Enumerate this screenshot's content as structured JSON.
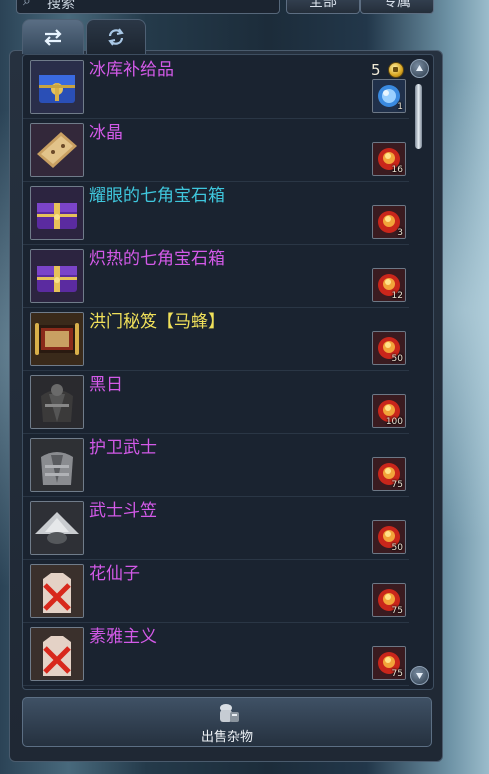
{
  "top": {
    "search_text": "搜索",
    "filter_all": "全部",
    "filter_special": "专属"
  },
  "tabs": [
    {
      "name": "exchange",
      "icon": "swap-arrows-icon",
      "active": true
    },
    {
      "name": "buyback",
      "icon": "refresh-icon",
      "active": false
    }
  ],
  "currency": {
    "gold_price": "5",
    "icon": "gold-coin-icon"
  },
  "items": [
    {
      "name": "冰库补给品",
      "color": "#d35ae8",
      "icon": "blue-chest-icon",
      "cost_icon": "blue-orb-token-icon",
      "cost_amount": "1"
    },
    {
      "name": "冰晶",
      "color": "#d35ae8",
      "icon": "ice-crystal-scroll-icon",
      "cost_icon": "fire-token-icon",
      "cost_amount": "16"
    },
    {
      "name": "耀眼的七角宝石箱",
      "color": "#3fc7dd",
      "icon": "purple-chest-icon",
      "cost_icon": "fire-token-icon",
      "cost_amount": "3"
    },
    {
      "name": "炽热的七角宝石箱",
      "color": "#d35ae8",
      "icon": "purple-chest-icon",
      "cost_icon": "fire-token-icon",
      "cost_amount": "12"
    },
    {
      "name": "洪门秘笈【马蜂】",
      "color": "#f0e05a",
      "icon": "scroll-icon",
      "cost_icon": "fire-token-icon",
      "cost_amount": "50"
    },
    {
      "name": "黑日",
      "color": "#d35ae8",
      "icon": "dark-armor-icon",
      "cost_icon": "fire-token-icon",
      "cost_amount": "100"
    },
    {
      "name": "护卫武士",
      "color": "#d35ae8",
      "icon": "armor-icon",
      "cost_icon": "fire-token-icon",
      "cost_amount": "75"
    },
    {
      "name": "武士斗笠",
      "color": "#d35ae8",
      "icon": "straw-hat-icon",
      "cost_icon": "fire-token-icon",
      "cost_amount": "50"
    },
    {
      "name": "花仙子",
      "color": "#d35ae8",
      "icon": "outfit-unavailable-icon",
      "cost_icon": "fire-token-icon",
      "cost_amount": "75"
    },
    {
      "name": "素雅主义",
      "color": "#d35ae8",
      "icon": "outfit-unavailable-icon",
      "cost_icon": "fire-token-icon",
      "cost_amount": "75"
    }
  ],
  "sell_button": {
    "label": "出售杂物",
    "icon": "sell-bag-icon"
  }
}
